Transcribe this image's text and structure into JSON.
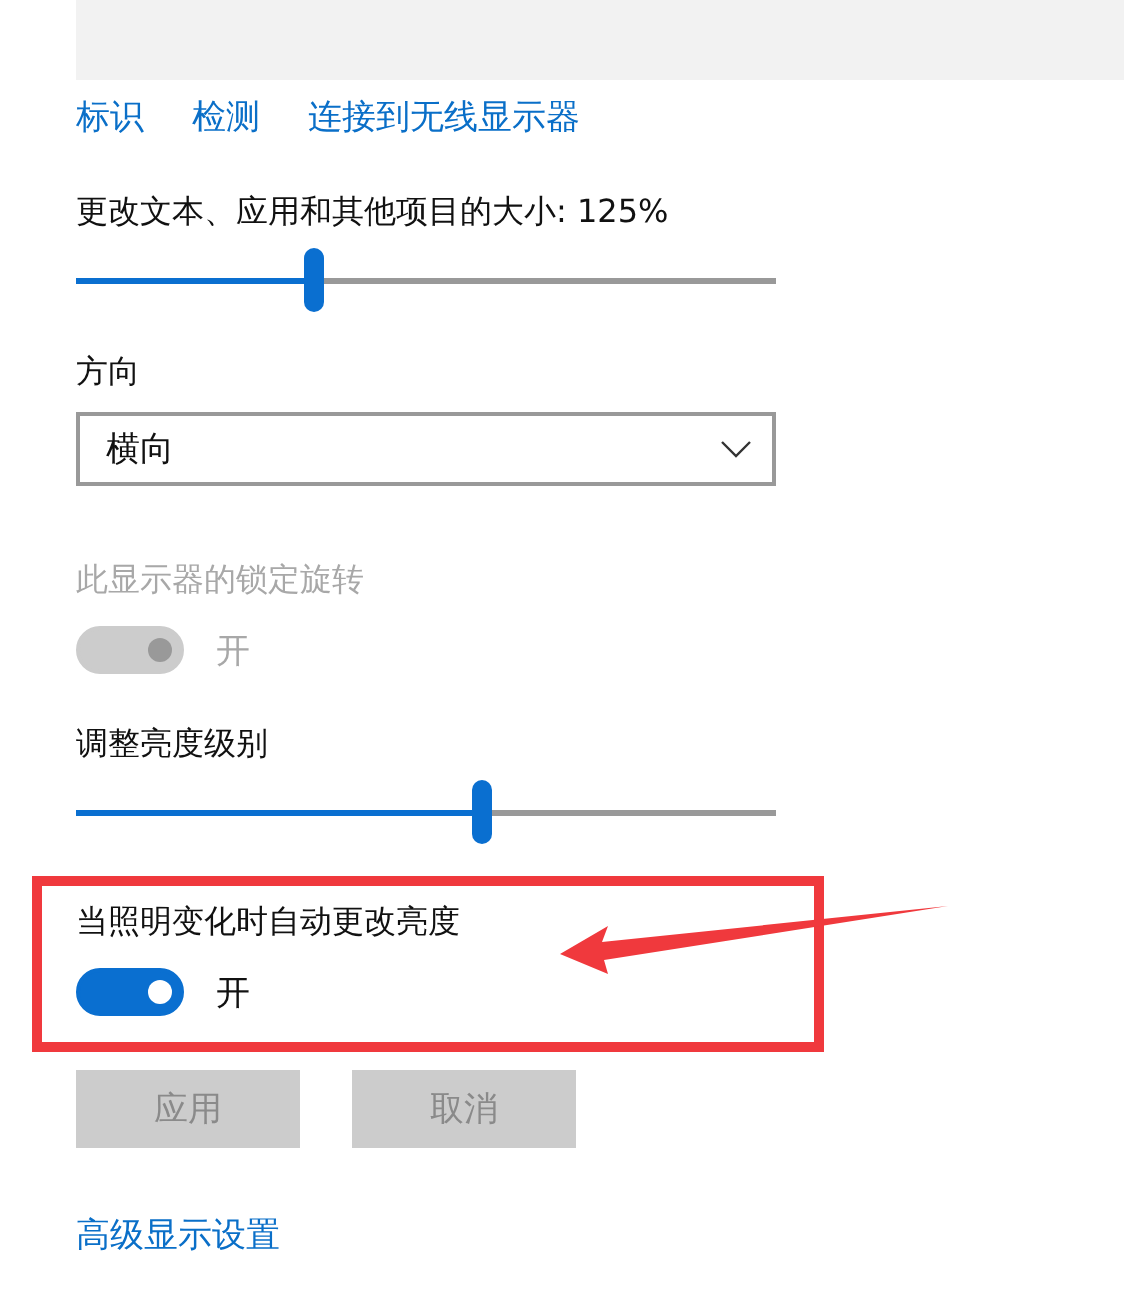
{
  "links": [
    {
      "label": "标识"
    },
    {
      "label": "检测"
    },
    {
      "label": "连接到无线显示器"
    }
  ],
  "scale": {
    "label": "更改文本、应用和其他项目的大小: 125%",
    "level": 0.34
  },
  "orientation": {
    "label": "方向",
    "value": "横向"
  },
  "rotation_lock": {
    "label": "此显示器的锁定旋转",
    "on": true,
    "disabled": true,
    "state_text": "开"
  },
  "brightness": {
    "label": "调整亮度级别",
    "level": 0.58
  },
  "auto_brightness": {
    "label": "当照明变化时自动更改亮度",
    "on": true,
    "disabled": false,
    "state_text": "开",
    "highlighted": true
  },
  "buttons": [
    {
      "label": "应用",
      "disabled": true
    },
    {
      "label": "取消",
      "disabled": true
    }
  ],
  "advanced_link": "高级显示设置"
}
